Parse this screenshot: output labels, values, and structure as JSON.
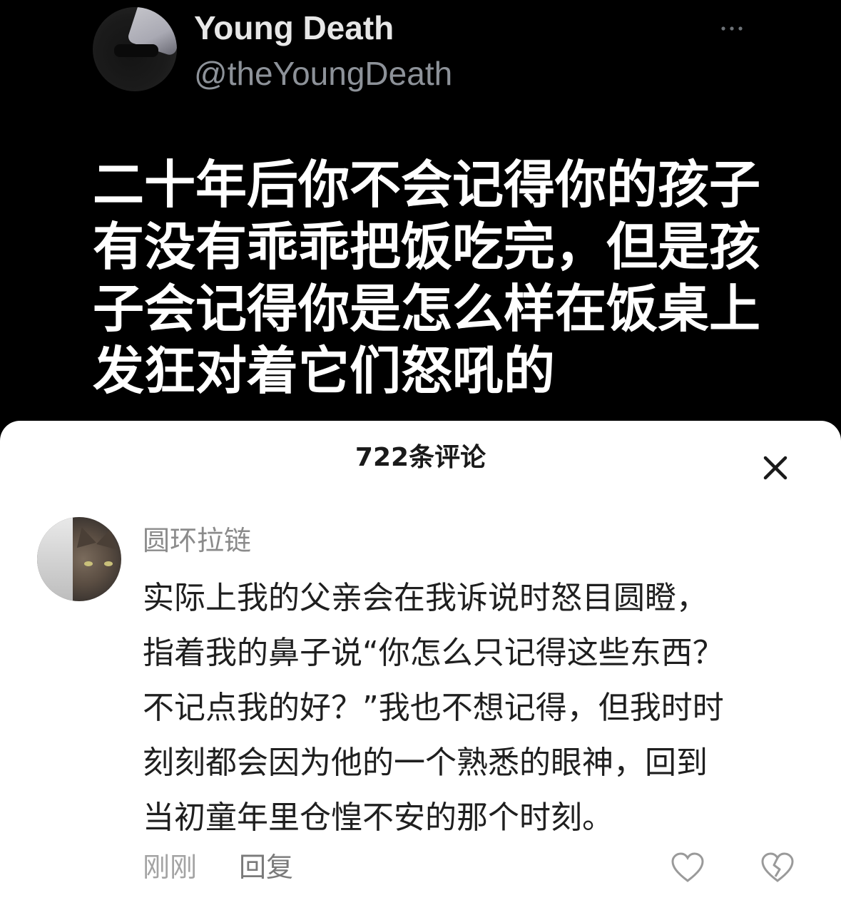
{
  "tweet": {
    "display_name": "Young Death",
    "handle": "@theYoungDeath",
    "text_lines": [
      "二十年后你不会记得你的孩子",
      "有没有乖乖把饭吃完，但是孩",
      "子会记得你是怎么样在饭桌上",
      "发狂对着它们怒吼的"
    ],
    "more_icon": "more-dots-icon"
  },
  "comments_sheet": {
    "title": "722条评论",
    "close_icon": "close-icon",
    "comment": {
      "username": "圆环拉链",
      "text_lines": [
        "实际上我的父亲会在我诉说时怒目圆瞪，",
        "指着我的鼻子说“你怎么只记得这些东西？",
        "不记点我的好？”我也不想记得，但我时时",
        "刻刻都会因为他的一个熟悉的眼神，回到",
        "当初童年里仓惶不安的那个时刻。"
      ],
      "time": "刚刚",
      "reply_label": "回复",
      "like_icon": "heart-icon",
      "dislike_icon": "broken-heart-icon"
    }
  },
  "colors": {
    "tweet_background": "#000000",
    "sheet_background": "#ffffff",
    "handle": "#8d9299",
    "meta_text": "#a3a3a3"
  }
}
